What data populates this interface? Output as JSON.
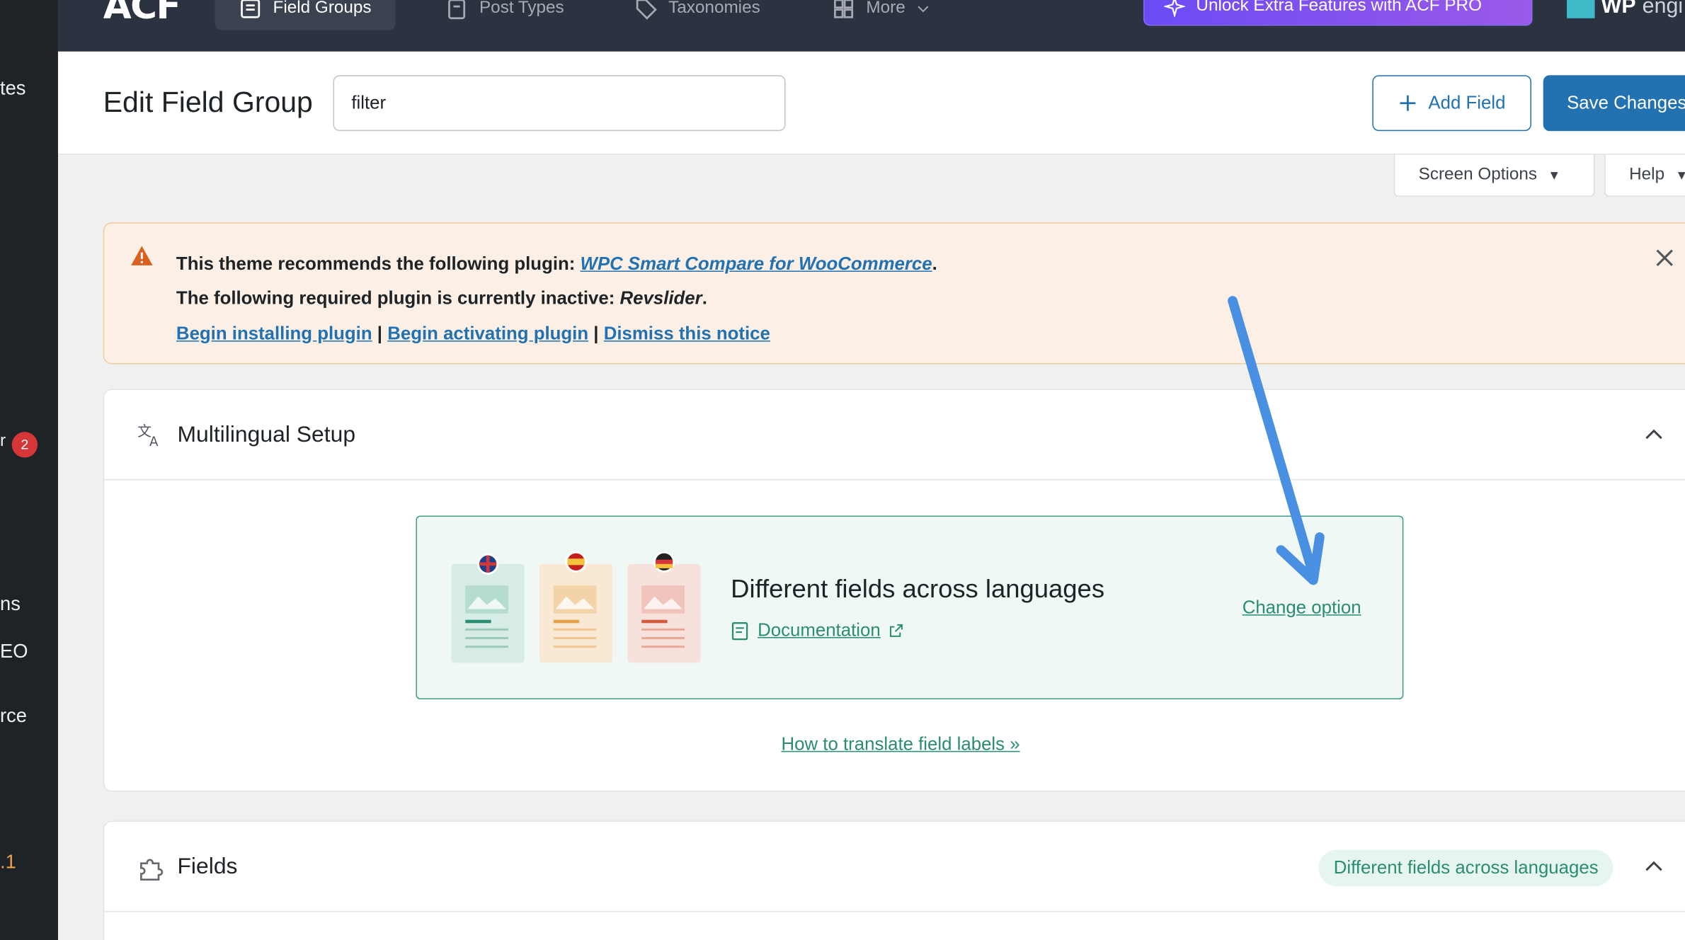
{
  "sidebar": {
    "fragments": [
      "tes",
      "ns",
      "EO",
      "rce",
      ".1"
    ],
    "badge_count": "2"
  },
  "nav": {
    "logo": "ACF",
    "tabs": [
      {
        "label": "Field Groups",
        "icon": "list-icon",
        "active": true
      },
      {
        "label": "Post Types",
        "icon": "document-icon",
        "active": false
      },
      {
        "label": "Taxonomies",
        "icon": "tag-icon",
        "active": false
      },
      {
        "label": "More",
        "icon": "grid-icon",
        "active": false
      }
    ],
    "unlock_label": "Unlock Extra Features with ACF PRO",
    "brand": "WP",
    "brand_suffix": "engi"
  },
  "header": {
    "title": "Edit Field Group",
    "name_value": "filter",
    "add_field_label": "Add Field",
    "save_label": "Save Changes"
  },
  "screen_options": {
    "screen_label": "Screen Options",
    "help_label": "Help"
  },
  "notice": {
    "line1_prefix": "This theme recommends the following plugin:",
    "line1_link": "WPC Smart Compare for WooCommerce",
    "line1_suffix": ".",
    "line2_prefix": "The following required plugin is currently inactive:",
    "line2_plugin": "Revslider",
    "line2_suffix": ".",
    "links": [
      "Begin installing plugin",
      "Begin activating plugin",
      "Dismiss this notice"
    ],
    "separator": "|"
  },
  "multilingual": {
    "title": "Multilingual Setup",
    "card_title": "Different fields across languages",
    "documentation_label": "Documentation",
    "change_option_label": "Change option",
    "howto_label": "How to translate field labels »"
  },
  "fields_panel": {
    "title": "Fields",
    "badge": "Different fields across languages"
  },
  "colors": {
    "acf_nav": "#2c3340",
    "wp_sidebar": "#1d2327",
    "primary": "#2271b1",
    "green": "#2a8d72",
    "notice_bg": "#fcf0e6",
    "annotation_arrow": "#4a90e2"
  }
}
